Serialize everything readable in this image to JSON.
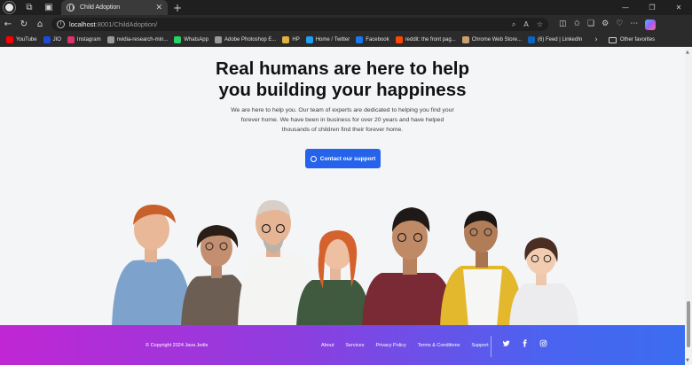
{
  "browser": {
    "tab_title": "Child Adoption",
    "url_host": "localhost",
    "url_path": ":8001/ChildAdoption/",
    "bookmarks": [
      {
        "label": "YouTube",
        "color": "#ff0000"
      },
      {
        "label": "JIO",
        "color": "#1d4bd8"
      },
      {
        "label": "Instagram",
        "color": "#e1306c"
      },
      {
        "label": "nvidia-research-min...",
        "color": "#9a9a9a"
      },
      {
        "label": "WhatsApp",
        "color": "#25d366"
      },
      {
        "label": "Adobe Photoshop E...",
        "color": "#9a9a9a"
      },
      {
        "label": "HP",
        "color": "#e0b040"
      },
      {
        "label": "Home / Twitter",
        "color": "#1da1f2"
      },
      {
        "label": "Facebook",
        "color": "#1877f2"
      },
      {
        "label": "reddit: the front pag...",
        "color": "#ff4500"
      },
      {
        "label": "Chrome Web Store...",
        "color": "#c9a26b"
      },
      {
        "label": "(6) Feed | LinkedIn",
        "color": "#0a66c2"
      }
    ],
    "other_favorites": "Other favorites"
  },
  "hero": {
    "title_line1": "Real humans are here to help",
    "title_line2": "you building your happiness",
    "sub_line1": "We are here to help you. Our team of experts are dedicated to helping you find your",
    "sub_line2": "forever home. We have been in business for over 20 years and have helped",
    "sub_line3": "thousands of children find their forever home.",
    "cta_label": "Contact our support",
    "accent": "#2563eb"
  },
  "footer": {
    "copyright": "© Copyright 2024 Java Jedis",
    "links": [
      "About",
      "Services",
      "Privacy Policy",
      "Terms & Conditions",
      "Support"
    ],
    "social_icons": [
      "twitter-icon",
      "facebook-icon",
      "instagram-icon"
    ],
    "gradient": [
      "#c026d3",
      "#3b6df0"
    ]
  }
}
